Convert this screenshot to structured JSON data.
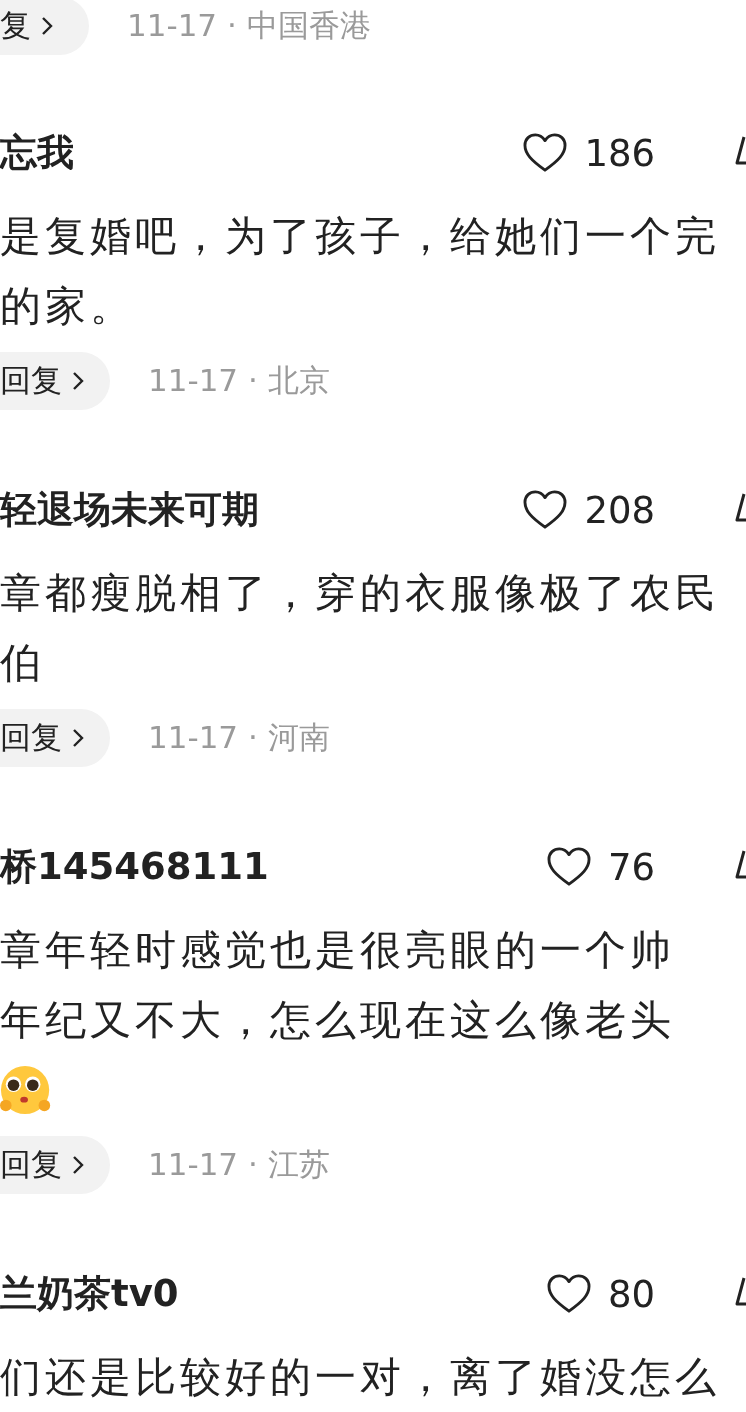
{
  "top_reply": {
    "reply_label": "复",
    "date": "11-17 · 中国香港"
  },
  "comments": [
    {
      "user": "忘我",
      "likes": "186",
      "lines": [
        "是复婚吧，为了孩子，给她们一个完",
        "的家。"
      ],
      "reply_label": "回复",
      "date": "11-17 · 北京"
    },
    {
      "user": "轻退场未来可期",
      "likes": "208",
      "lines": [
        "章都瘦脱相了，穿的衣服像极了农民",
        "伯"
      ],
      "reply_label": "回复",
      "date": "11-17 · 河南"
    },
    {
      "user": "桥145468111",
      "likes": "76",
      "lines": [
        "章年轻时感觉也是很亮眼的一个帅",
        "年纪又不大，怎么现在这么像老头"
      ],
      "has_emoji": true,
      "reply_label": "回复",
      "date": "11-17 · 江苏"
    },
    {
      "user": "兰奶茶tv0",
      "likes": "80",
      "lines": [
        "们还是比较好的一对，离了婚没怎么"
      ]
    }
  ]
}
